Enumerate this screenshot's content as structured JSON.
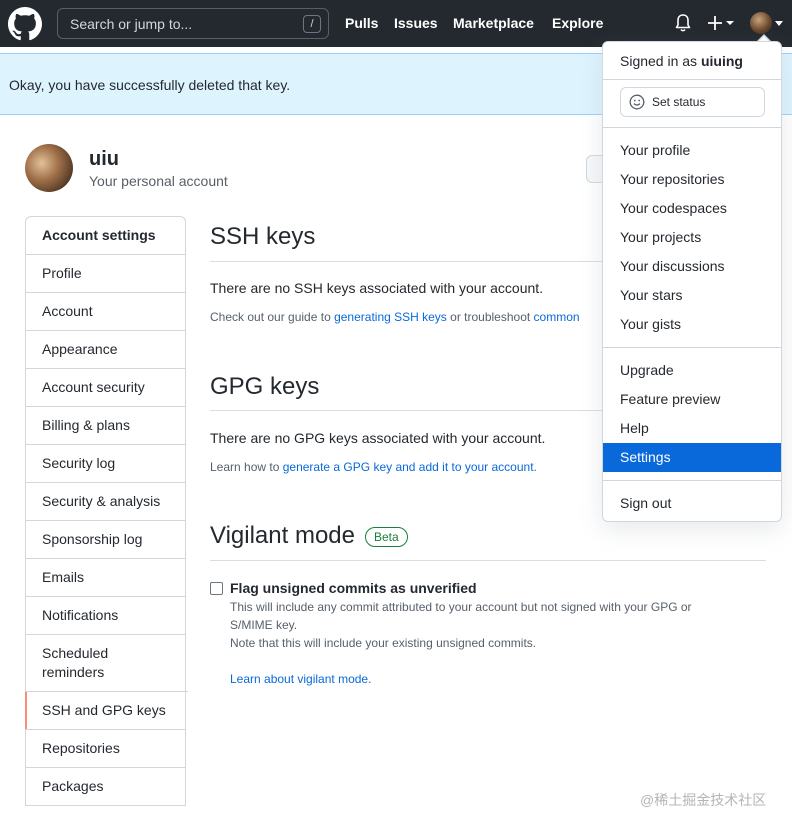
{
  "header": {
    "search_placeholder": "Search or jump to...",
    "search_shortcut": "/",
    "nav": [
      "Pulls",
      "Issues",
      "Marketplace",
      "Explore"
    ]
  },
  "flash": {
    "message": "Okay, you have successfully deleted that key."
  },
  "profile": {
    "username": "uiu",
    "subtitle": "Your personal account"
  },
  "sidebar": {
    "heading": "Account settings",
    "items": [
      "Profile",
      "Account",
      "Appearance",
      "Account security",
      "Billing & plans",
      "Security log",
      "Security & analysis",
      "Sponsorship log",
      "Emails",
      "Notifications",
      "Scheduled reminders",
      "SSH and GPG keys",
      "Repositories",
      "Packages"
    ],
    "selected": "SSH and GPG keys"
  },
  "ssh": {
    "title": "SSH keys",
    "empty": "There are no SSH keys associated with your account.",
    "help_prefix": "Check out our guide to ",
    "help_link1": "generating SSH keys",
    "help_middle": " or troubleshoot ",
    "help_link2": "common"
  },
  "gpg": {
    "title": "GPG keys",
    "empty": "There are no GPG keys associated with your account.",
    "help_prefix": "Learn how to ",
    "help_link": "generate a GPG key and add it to your account",
    "help_suffix": "."
  },
  "vigilant": {
    "title": "Vigilant mode",
    "badge": "Beta",
    "checkbox_label": "Flag unsigned commits as unverified",
    "desc_line1": "This will include any commit attributed to your account but not signed with your GPG or",
    "desc_line2": "S/MIME key.",
    "desc_line3": "Note that this will include your existing unsigned commits.",
    "learn_link": "Learn about vigilant mode."
  },
  "dropdown": {
    "signed_in_prefix": "Signed in as ",
    "signed_in_user": "uiuing",
    "set_status": "Set status",
    "group1": [
      "Your profile",
      "Your repositories",
      "Your codespaces",
      "Your projects",
      "Your discussions",
      "Your stars",
      "Your gists"
    ],
    "group2": [
      "Upgrade",
      "Feature preview",
      "Help",
      "Settings"
    ],
    "active": "Settings",
    "sign_out": "Sign out"
  },
  "watermark": "@稀土掘金技术社区",
  "colors": {
    "header_bg": "#24292f",
    "flash_bg": "#ddf4ff",
    "link": "#0969da",
    "selected_accent": "#fd8c73",
    "active_menu": "#0969da",
    "beta_green": "#1a7f37"
  }
}
